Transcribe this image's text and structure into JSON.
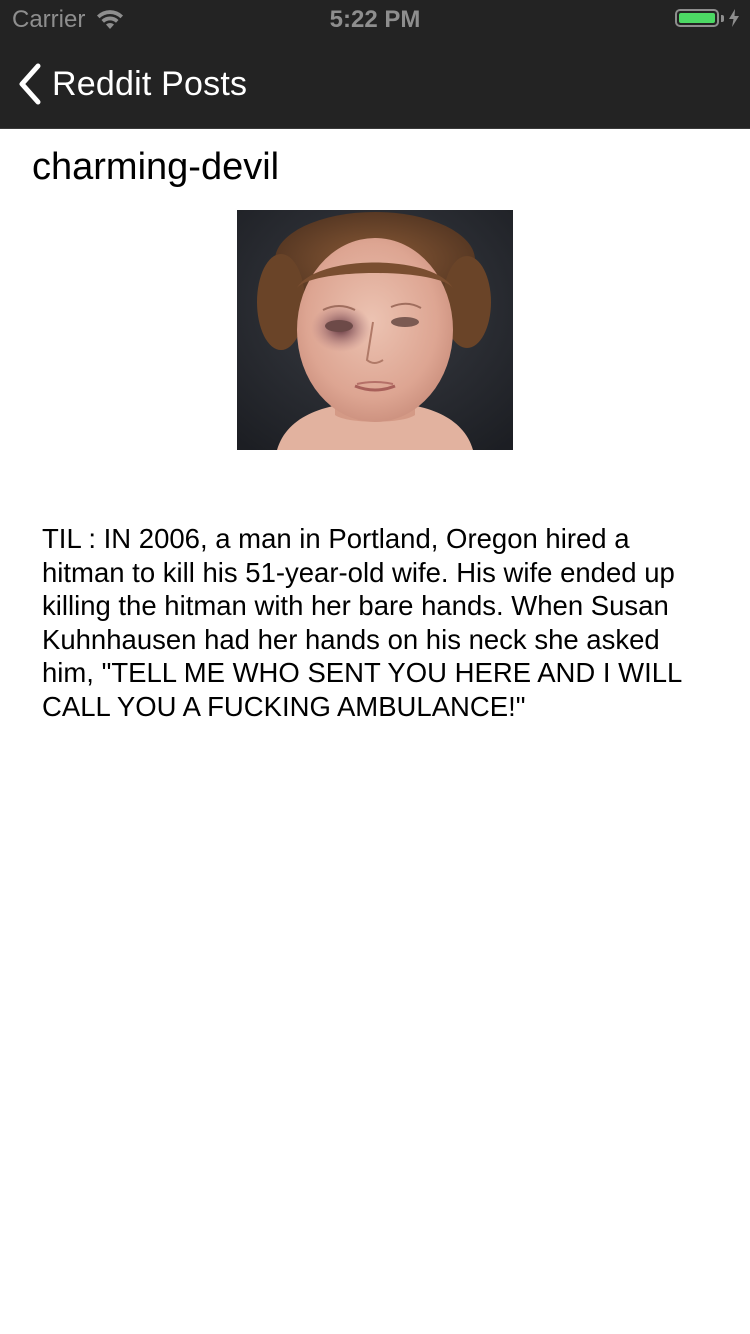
{
  "status_bar": {
    "carrier": "Carrier",
    "time": "5:22 PM",
    "battery_level": 1.0,
    "battery_color": "#4cd964",
    "charging": true
  },
  "nav": {
    "back_label": "Reddit Posts",
    "back_icon": "chevron-left-icon",
    "background_color": "#232323"
  },
  "post": {
    "author": "charming-devil",
    "title": "TIL : IN 2006, a man in Portland, Oregon hired a hitman to kill his 51-year-old wife. His wife ended up killing the hitman with her bare hands. When Susan Kuhnhausen had her hands on his neck she asked him, \"TELL ME WHO SENT YOU HERE AND I WILL CALL YOU A FUCKING AMBULANCE!\""
  }
}
